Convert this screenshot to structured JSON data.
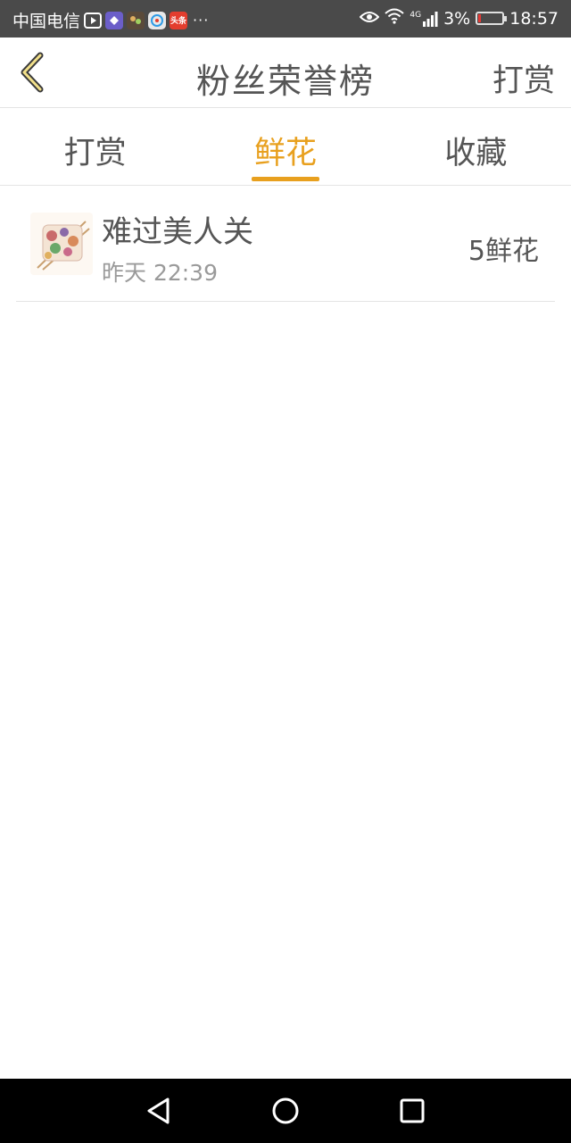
{
  "status_bar": {
    "carrier": "中国电信",
    "app_badge": "头条",
    "more": "···",
    "network": "4G",
    "battery": "3%",
    "battery_level": 0.03,
    "time": "18:57"
  },
  "header": {
    "back_icon": "chevron-left-icon",
    "title": "粉丝荣誉榜",
    "action_label": "打赏"
  },
  "tabs": [
    {
      "label": "打赏",
      "active": false
    },
    {
      "label": "鲜花",
      "active": true
    },
    {
      "label": "收藏",
      "active": false
    }
  ],
  "list": [
    {
      "name": "难过美人关",
      "time": "昨天 22:39",
      "amount": "5鲜花",
      "avatar_icon": "grilled-skewers-avatar"
    }
  ],
  "colors": {
    "accent": "#e8a01e",
    "status_bar_bg": "#4a4a4a",
    "text": "#555555",
    "subtext": "#9a9a9a",
    "divider": "#e4e4e4"
  },
  "nav_bar": {
    "icons": [
      "triangle-back-icon",
      "circle-home-icon",
      "square-recent-icon"
    ]
  }
}
